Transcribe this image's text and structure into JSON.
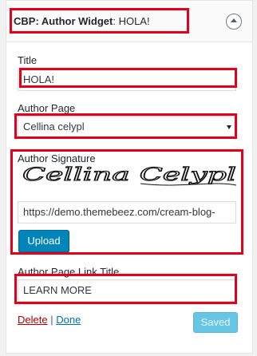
{
  "widget": {
    "title_prefix": "CBP: Author Widget",
    "title_colon": ": ",
    "title_instance": "HOLA!"
  },
  "fields": {
    "title_label": "Title",
    "title_value": "HOLA!",
    "author_page_label": "Author Page",
    "author_page_selected": "Cellina celypl",
    "signature_label": "Author Signature",
    "signature_text": "Cellina Celypl",
    "signature_url": "https://demo.themebeez.com/cream-blog-",
    "upload_label": "Upload",
    "link_title_label": "Author Page Link Title",
    "link_title_value": "LEARN MORE"
  },
  "footer": {
    "delete_label": "Delete",
    "separator": "|",
    "done_label": "Done",
    "saved_label": "Saved"
  },
  "icons": {
    "toggle": "chevron-up-icon",
    "select": "chevron-down-icon"
  },
  "colors": {
    "highlight": "#e4001b",
    "primary": "#0085ba",
    "saved": "#66c6e4",
    "delete": "#a00000",
    "link": "#0073aa"
  }
}
